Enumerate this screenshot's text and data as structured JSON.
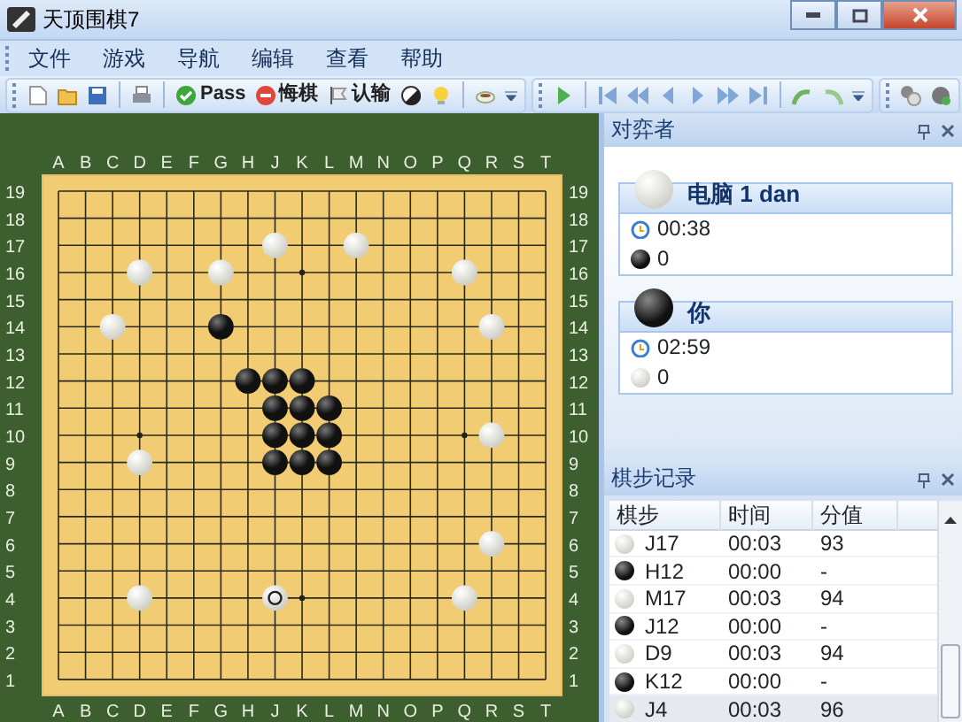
{
  "window": {
    "title": "天顶围棋7"
  },
  "menu": [
    {
      "label": "文件"
    },
    {
      "label": "游戏"
    },
    {
      "label": "导航"
    },
    {
      "label": "编辑"
    },
    {
      "label": "查看"
    },
    {
      "label": "帮助"
    }
  ],
  "toolbar": {
    "buttons": [
      {
        "label": "Pass"
      },
      {
        "label": "悔棋"
      },
      {
        "label": "认输"
      }
    ]
  },
  "board": {
    "top_column_labels": [
      "A",
      "B",
      "C",
      "D",
      "E",
      "F",
      "G",
      "H",
      "J",
      "K",
      "L",
      "M",
      "N",
      "O",
      "P",
      "Q",
      "R",
      "S",
      "T"
    ],
    "bottom_column_labels": [
      "A",
      "B",
      "C",
      "D",
      "E",
      "F",
      "G",
      "H",
      "J",
      "K",
      "L",
      "M",
      "N",
      "O",
      "P",
      "Q",
      "R",
      "S",
      "T"
    ],
    "left_row_labels": [
      "19",
      "18",
      "17",
      "16",
      "15",
      "14",
      "13",
      "12",
      "11",
      "10",
      "9",
      "8",
      "7",
      "6",
      "5",
      "4",
      "3",
      "2",
      "1"
    ],
    "right_row_labels": [
      "19",
      "18",
      "17",
      "16",
      "15",
      "14",
      "13",
      "12",
      "11",
      "10",
      "9",
      "8",
      "7",
      "6",
      "5",
      "4",
      "3",
      "2",
      "1"
    ],
    "grid": [
      [
        {
          "kind": "empty"
        },
        {
          "kind": "empty"
        },
        {
          "kind": "empty"
        },
        {
          "kind": "empty"
        },
        {
          "kind": "empty"
        },
        {
          "kind": "empty"
        },
        {
          "kind": "empty"
        },
        {
          "kind": "empty"
        },
        {
          "kind": "empty"
        },
        {
          "kind": "empty"
        },
        {
          "kind": "empty"
        },
        {
          "kind": "empty"
        },
        {
          "kind": "empty"
        },
        {
          "kind": "empty"
        },
        {
          "kind": "empty"
        },
        {
          "kind": "empty"
        },
        {
          "kind": "empty"
        },
        {
          "kind": "empty"
        },
        {
          "kind": "empty"
        }
      ],
      [
        {
          "kind": "empty"
        },
        {
          "kind": "empty"
        },
        {
          "kind": "empty"
        },
        {
          "kind": "empty"
        },
        {
          "kind": "empty"
        },
        {
          "kind": "empty"
        },
        {
          "kind": "empty"
        },
        {
          "kind": "empty"
        },
        {
          "kind": "empty"
        },
        {
          "kind": "empty"
        },
        {
          "kind": "empty"
        },
        {
          "kind": "empty"
        },
        {
          "kind": "empty"
        },
        {
          "kind": "empty"
        },
        {
          "kind": "empty"
        },
        {
          "kind": "empty"
        },
        {
          "kind": "empty"
        },
        {
          "kind": "empty"
        },
        {
          "kind": "empty"
        }
      ],
      [
        {
          "kind": "empty"
        },
        {
          "kind": "empty"
        },
        {
          "kind": "empty"
        },
        {
          "kind": "empty"
        },
        {
          "kind": "empty"
        },
        {
          "kind": "empty"
        },
        {
          "kind": "empty"
        },
        {
          "kind": "empty"
        },
        {
          "kind": "white",
          "last_move": false
        },
        {
          "kind": "empty"
        },
        {
          "kind": "empty"
        },
        {
          "kind": "white",
          "last_move": false
        },
        {
          "kind": "empty"
        },
        {
          "kind": "empty"
        },
        {
          "kind": "empty"
        },
        {
          "kind": "empty"
        },
        {
          "kind": "empty"
        },
        {
          "kind": "empty"
        },
        {
          "kind": "empty"
        }
      ],
      [
        {
          "kind": "empty"
        },
        {
          "kind": "empty"
        },
        {
          "kind": "empty"
        },
        {
          "kind": "white",
          "last_move": false
        },
        {
          "kind": "empty"
        },
        {
          "kind": "empty"
        },
        {
          "kind": "white",
          "last_move": false
        },
        {
          "kind": "empty"
        },
        {
          "kind": "empty"
        },
        {
          "kind": "empty"
        },
        {
          "kind": "empty"
        },
        {
          "kind": "empty"
        },
        {
          "kind": "empty"
        },
        {
          "kind": "empty"
        },
        {
          "kind": "empty"
        },
        {
          "kind": "white",
          "last_move": false
        },
        {
          "kind": "empty"
        },
        {
          "kind": "empty"
        },
        {
          "kind": "empty"
        }
      ],
      [
        {
          "kind": "empty"
        },
        {
          "kind": "empty"
        },
        {
          "kind": "empty"
        },
        {
          "kind": "empty"
        },
        {
          "kind": "empty"
        },
        {
          "kind": "empty"
        },
        {
          "kind": "empty"
        },
        {
          "kind": "empty"
        },
        {
          "kind": "empty"
        },
        {
          "kind": "empty"
        },
        {
          "kind": "empty"
        },
        {
          "kind": "empty"
        },
        {
          "kind": "empty"
        },
        {
          "kind": "empty"
        },
        {
          "kind": "empty"
        },
        {
          "kind": "empty"
        },
        {
          "kind": "empty"
        },
        {
          "kind": "empty"
        },
        {
          "kind": "empty"
        }
      ],
      [
        {
          "kind": "empty"
        },
        {
          "kind": "empty"
        },
        {
          "kind": "white",
          "last_move": false
        },
        {
          "kind": "empty"
        },
        {
          "kind": "empty"
        },
        {
          "kind": "empty"
        },
        {
          "kind": "black",
          "last_move": false
        },
        {
          "kind": "empty"
        },
        {
          "kind": "empty"
        },
        {
          "kind": "empty"
        },
        {
          "kind": "empty"
        },
        {
          "kind": "empty"
        },
        {
          "kind": "empty"
        },
        {
          "kind": "empty"
        },
        {
          "kind": "empty"
        },
        {
          "kind": "empty"
        },
        {
          "kind": "white",
          "last_move": false
        },
        {
          "kind": "empty"
        },
        {
          "kind": "empty"
        }
      ],
      [
        {
          "kind": "empty"
        },
        {
          "kind": "empty"
        },
        {
          "kind": "empty"
        },
        {
          "kind": "empty"
        },
        {
          "kind": "empty"
        },
        {
          "kind": "empty"
        },
        {
          "kind": "empty"
        },
        {
          "kind": "empty"
        },
        {
          "kind": "empty"
        },
        {
          "kind": "empty"
        },
        {
          "kind": "empty"
        },
        {
          "kind": "empty"
        },
        {
          "kind": "empty"
        },
        {
          "kind": "empty"
        },
        {
          "kind": "empty"
        },
        {
          "kind": "empty"
        },
        {
          "kind": "empty"
        },
        {
          "kind": "empty"
        },
        {
          "kind": "empty"
        }
      ],
      [
        {
          "kind": "empty"
        },
        {
          "kind": "empty"
        },
        {
          "kind": "empty"
        },
        {
          "kind": "empty"
        },
        {
          "kind": "empty"
        },
        {
          "kind": "empty"
        },
        {
          "kind": "empty"
        },
        {
          "kind": "black",
          "last_move": false
        },
        {
          "kind": "black",
          "last_move": false
        },
        {
          "kind": "black",
          "last_move": false
        },
        {
          "kind": "empty"
        },
        {
          "kind": "empty"
        },
        {
          "kind": "empty"
        },
        {
          "kind": "empty"
        },
        {
          "kind": "empty"
        },
        {
          "kind": "empty"
        },
        {
          "kind": "empty"
        },
        {
          "kind": "empty"
        },
        {
          "kind": "empty"
        }
      ],
      [
        {
          "kind": "empty"
        },
        {
          "kind": "empty"
        },
        {
          "kind": "empty"
        },
        {
          "kind": "empty"
        },
        {
          "kind": "empty"
        },
        {
          "kind": "empty"
        },
        {
          "kind": "empty"
        },
        {
          "kind": "empty"
        },
        {
          "kind": "black",
          "last_move": false
        },
        {
          "kind": "black",
          "last_move": false
        },
        {
          "kind": "black",
          "last_move": false
        },
        {
          "kind": "empty"
        },
        {
          "kind": "empty"
        },
        {
          "kind": "empty"
        },
        {
          "kind": "empty"
        },
        {
          "kind": "empty"
        },
        {
          "kind": "empty"
        },
        {
          "kind": "empty"
        },
        {
          "kind": "empty"
        }
      ],
      [
        {
          "kind": "empty"
        },
        {
          "kind": "empty"
        },
        {
          "kind": "empty"
        },
        {
          "kind": "empty"
        },
        {
          "kind": "empty"
        },
        {
          "kind": "empty"
        },
        {
          "kind": "empty"
        },
        {
          "kind": "empty"
        },
        {
          "kind": "black",
          "last_move": false
        },
        {
          "kind": "black",
          "last_move": false
        },
        {
          "kind": "black",
          "last_move": false
        },
        {
          "kind": "empty"
        },
        {
          "kind": "empty"
        },
        {
          "kind": "empty"
        },
        {
          "kind": "empty"
        },
        {
          "kind": "empty"
        },
        {
          "kind": "white",
          "last_move": false
        },
        {
          "kind": "empty"
        },
        {
          "kind": "empty"
        }
      ],
      [
        {
          "kind": "empty"
        },
        {
          "kind": "empty"
        },
        {
          "kind": "empty"
        },
        {
          "kind": "white",
          "last_move": false
        },
        {
          "kind": "empty"
        },
        {
          "kind": "empty"
        },
        {
          "kind": "empty"
        },
        {
          "kind": "empty"
        },
        {
          "kind": "black",
          "last_move": false
        },
        {
          "kind": "black",
          "last_move": false
        },
        {
          "kind": "black",
          "last_move": false
        },
        {
          "kind": "empty"
        },
        {
          "kind": "empty"
        },
        {
          "kind": "empty"
        },
        {
          "kind": "empty"
        },
        {
          "kind": "empty"
        },
        {
          "kind": "empty"
        },
        {
          "kind": "empty"
        },
        {
          "kind": "empty"
        }
      ],
      [
        {
          "kind": "empty"
        },
        {
          "kind": "empty"
        },
        {
          "kind": "empty"
        },
        {
          "kind": "empty"
        },
        {
          "kind": "empty"
        },
        {
          "kind": "empty"
        },
        {
          "kind": "empty"
        },
        {
          "kind": "empty"
        },
        {
          "kind": "empty"
        },
        {
          "kind": "empty"
        },
        {
          "kind": "empty"
        },
        {
          "kind": "empty"
        },
        {
          "kind": "empty"
        },
        {
          "kind": "empty"
        },
        {
          "kind": "empty"
        },
        {
          "kind": "empty"
        },
        {
          "kind": "empty"
        },
        {
          "kind": "empty"
        },
        {
          "kind": "empty"
        }
      ],
      [
        {
          "kind": "empty"
        },
        {
          "kind": "empty"
        },
        {
          "kind": "empty"
        },
        {
          "kind": "empty"
        },
        {
          "kind": "empty"
        },
        {
          "kind": "empty"
        },
        {
          "kind": "empty"
        },
        {
          "kind": "empty"
        },
        {
          "kind": "empty"
        },
        {
          "kind": "empty"
        },
        {
          "kind": "empty"
        },
        {
          "kind": "empty"
        },
        {
          "kind": "empty"
        },
        {
          "kind": "empty"
        },
        {
          "kind": "empty"
        },
        {
          "kind": "empty"
        },
        {
          "kind": "empty"
        },
        {
          "kind": "empty"
        },
        {
          "kind": "empty"
        }
      ],
      [
        {
          "kind": "empty"
        },
        {
          "kind": "empty"
        },
        {
          "kind": "empty"
        },
        {
          "kind": "empty"
        },
        {
          "kind": "empty"
        },
        {
          "kind": "empty"
        },
        {
          "kind": "empty"
        },
        {
          "kind": "empty"
        },
        {
          "kind": "empty"
        },
        {
          "kind": "empty"
        },
        {
          "kind": "empty"
        },
        {
          "kind": "empty"
        },
        {
          "kind": "empty"
        },
        {
          "kind": "empty"
        },
        {
          "kind": "empty"
        },
        {
          "kind": "empty"
        },
        {
          "kind": "white",
          "last_move": false
        },
        {
          "kind": "empty"
        },
        {
          "kind": "empty"
        }
      ],
      [
        {
          "kind": "empty"
        },
        {
          "kind": "empty"
        },
        {
          "kind": "empty"
        },
        {
          "kind": "empty"
        },
        {
          "kind": "empty"
        },
        {
          "kind": "empty"
        },
        {
          "kind": "empty"
        },
        {
          "kind": "empty"
        },
        {
          "kind": "empty"
        },
        {
          "kind": "empty"
        },
        {
          "kind": "empty"
        },
        {
          "kind": "empty"
        },
        {
          "kind": "empty"
        },
        {
          "kind": "empty"
        },
        {
          "kind": "empty"
        },
        {
          "kind": "empty"
        },
        {
          "kind": "empty"
        },
        {
          "kind": "empty"
        },
        {
          "kind": "empty"
        }
      ],
      [
        {
          "kind": "empty"
        },
        {
          "kind": "empty"
        },
        {
          "kind": "empty"
        },
        {
          "kind": "white",
          "last_move": false
        },
        {
          "kind": "empty"
        },
        {
          "kind": "empty"
        },
        {
          "kind": "empty"
        },
        {
          "kind": "empty"
        },
        {
          "kind": "white",
          "last_move": true
        },
        {
          "kind": "empty"
        },
        {
          "kind": "empty"
        },
        {
          "kind": "empty"
        },
        {
          "kind": "empty"
        },
        {
          "kind": "empty"
        },
        {
          "kind": "empty"
        },
        {
          "kind": "white",
          "last_move": false
        },
        {
          "kind": "empty"
        },
        {
          "kind": "empty"
        },
        {
          "kind": "empty"
        }
      ],
      [
        {
          "kind": "empty"
        },
        {
          "kind": "empty"
        },
        {
          "kind": "empty"
        },
        {
          "kind": "empty"
        },
        {
          "kind": "empty"
        },
        {
          "kind": "empty"
        },
        {
          "kind": "empty"
        },
        {
          "kind": "empty"
        },
        {
          "kind": "empty"
        },
        {
          "kind": "empty"
        },
        {
          "kind": "empty"
        },
        {
          "kind": "empty"
        },
        {
          "kind": "empty"
        },
        {
          "kind": "empty"
        },
        {
          "kind": "empty"
        },
        {
          "kind": "empty"
        },
        {
          "kind": "empty"
        },
        {
          "kind": "empty"
        },
        {
          "kind": "empty"
        }
      ],
      [
        {
          "kind": "empty"
        },
        {
          "kind": "empty"
        },
        {
          "kind": "empty"
        },
        {
          "kind": "empty"
        },
        {
          "kind": "empty"
        },
        {
          "kind": "empty"
        },
        {
          "kind": "empty"
        },
        {
          "kind": "empty"
        },
        {
          "kind": "empty"
        },
        {
          "kind": "empty"
        },
        {
          "kind": "empty"
        },
        {
          "kind": "empty"
        },
        {
          "kind": "empty"
        },
        {
          "kind": "empty"
        },
        {
          "kind": "empty"
        },
        {
          "kind": "empty"
        },
        {
          "kind": "empty"
        },
        {
          "kind": "empty"
        },
        {
          "kind": "empty"
        }
      ],
      [
        {
          "kind": "empty"
        },
        {
          "kind": "empty"
        },
        {
          "kind": "empty"
        },
        {
          "kind": "empty"
        },
        {
          "kind": "empty"
        },
        {
          "kind": "empty"
        },
        {
          "kind": "empty"
        },
        {
          "kind": "empty"
        },
        {
          "kind": "empty"
        },
        {
          "kind": "empty"
        },
        {
          "kind": "empty"
        },
        {
          "kind": "empty"
        },
        {
          "kind": "empty"
        },
        {
          "kind": "empty"
        },
        {
          "kind": "empty"
        },
        {
          "kind": "empty"
        },
        {
          "kind": "empty"
        },
        {
          "kind": "empty"
        },
        {
          "kind": "empty"
        }
      ]
    ]
  },
  "players_panel": {
    "title": "对弈者",
    "players": [
      {
        "name": "电脑 1 dan",
        "kind": "white",
        "time": "00:38",
        "captures": "0"
      },
      {
        "name": "你",
        "kind": "black",
        "time": "02:59",
        "captures": "0"
      }
    ]
  },
  "moves_panel": {
    "title": "棋步记录",
    "columns": [
      "棋步",
      "时间",
      "分值"
    ],
    "rows": [
      {
        "kind": "white",
        "move": "J17",
        "time": "00:03",
        "score": "93",
        "selected": false
      },
      {
        "kind": "black",
        "move": "H12",
        "time": "00:00",
        "score": "-",
        "selected": false
      },
      {
        "kind": "white",
        "move": "M17",
        "time": "00:03",
        "score": "94",
        "selected": false
      },
      {
        "kind": "black",
        "move": "J12",
        "time": "00:00",
        "score": "-",
        "selected": false
      },
      {
        "kind": "white",
        "move": "D9",
        "time": "00:03",
        "score": "94",
        "selected": false
      },
      {
        "kind": "black",
        "move": "K12",
        "time": "00:00",
        "score": "-",
        "selected": false
      },
      {
        "kind": "white",
        "move": "J4",
        "time": "00:03",
        "score": "96",
        "selected": true
      }
    ]
  }
}
